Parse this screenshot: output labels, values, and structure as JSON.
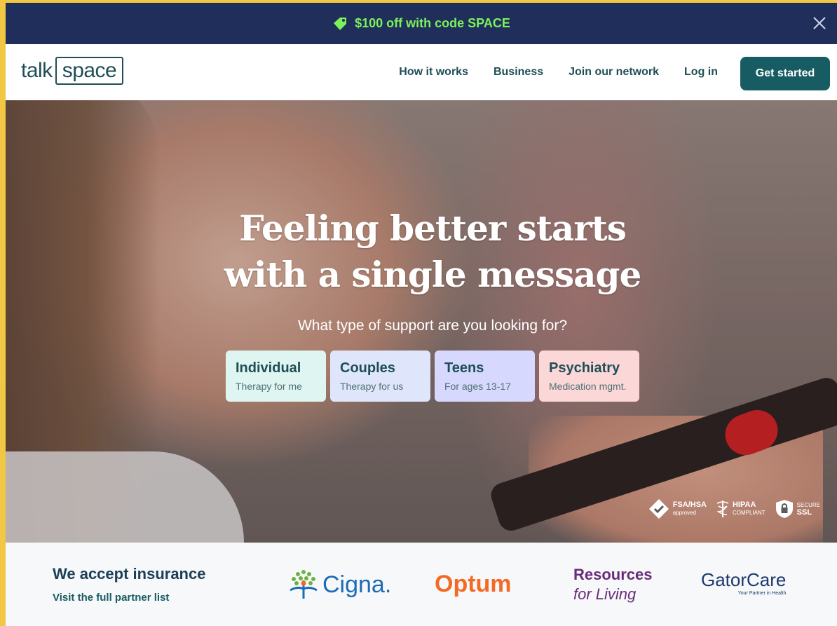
{
  "promo": {
    "text": "$100 off with code SPACE"
  },
  "logo": {
    "part1": "talk",
    "part2": "space"
  },
  "nav": {
    "links": [
      "How it works",
      "Business",
      "Join our network",
      "Log in"
    ],
    "cta": "Get started"
  },
  "hero": {
    "headline_line1": "Feeling better starts",
    "headline_line2": "with a single message",
    "subhead": "What type of support are you looking for?",
    "cards": [
      {
        "title": "Individual",
        "sub": "Therapy for me",
        "color": "#dff5f1"
      },
      {
        "title": "Couples",
        "sub": "Therapy for us",
        "color": "#dfe6fb"
      },
      {
        "title": "Teens",
        "sub": "For ages 13-17",
        "color": "#d6d8fd"
      },
      {
        "title": "Psychiatry",
        "sub": "Medication mgmt.",
        "color": "#fbd7d7"
      }
    ],
    "badges": {
      "fsa": "FSA/HSA",
      "fsa_sub": "approved",
      "hipaa": "HIPAA",
      "hipaa_sub": "COMPLIANT",
      "ssl_top": "SECURE",
      "ssl": "SSL"
    }
  },
  "insurance": {
    "title": "We accept insurance",
    "link": "Visit the full partner list",
    "partners": {
      "cigna": "Cigna.",
      "optum": "Optum",
      "rfl_line1": "Resources",
      "rfl_line2": "for Living",
      "gator": "GatorCare",
      "gator_tag": "Your Partner in Health"
    }
  }
}
